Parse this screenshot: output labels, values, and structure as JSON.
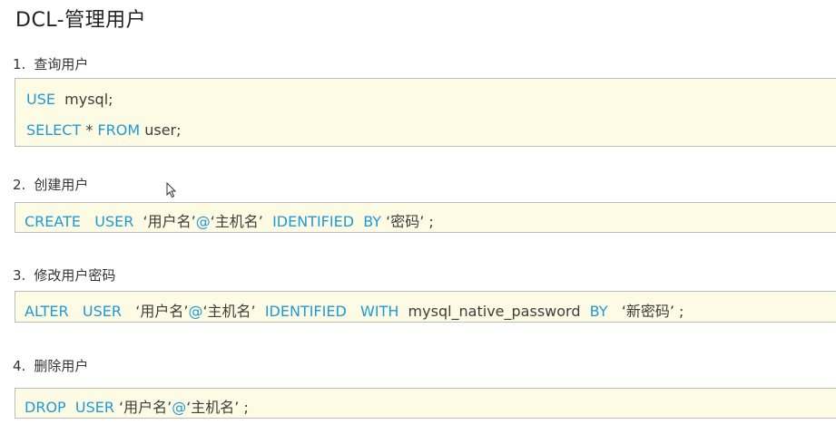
{
  "page": {
    "title": "DCL-管理用户"
  },
  "sections": [
    {
      "number": "1.",
      "heading": "查询用户",
      "code_lines": [
        [
          {
            "text": "USE",
            "kw": true
          },
          {
            "text": "  mysql;",
            "kw": false
          }
        ],
        [
          {
            "text": "SELECT",
            "kw": true
          },
          {
            "text": " * ",
            "kw": false
          },
          {
            "text": "FROM",
            "kw": true
          },
          {
            "text": " user;",
            "kw": false
          }
        ]
      ]
    },
    {
      "number": "2.",
      "heading": "创建用户",
      "code_lines": [
        [
          {
            "text": "CREATE   USER",
            "kw": true
          },
          {
            "text": "  ‘用户名’",
            "kw": false
          },
          {
            "text": "@",
            "kw": true
          },
          {
            "text": "‘主机名’  ",
            "kw": false
          },
          {
            "text": "IDENTIFIED  BY",
            "kw": true
          },
          {
            "text": " ‘密码’ ;",
            "kw": false
          }
        ]
      ]
    },
    {
      "number": "3.",
      "heading": "修改用户密码",
      "code_lines": [
        [
          {
            "text": "ALTER   USER",
            "kw": true
          },
          {
            "text": "   ‘用户名’",
            "kw": false
          },
          {
            "text": "@",
            "kw": true
          },
          {
            "text": "‘主机名’  ",
            "kw": false
          },
          {
            "text": "IDENTIFIED   WITH",
            "kw": true
          },
          {
            "text": "  mysql_native_password  ",
            "kw": false
          },
          {
            "text": "BY",
            "kw": true
          },
          {
            "text": "   ‘新密码’ ;",
            "kw": false
          }
        ]
      ]
    },
    {
      "number": "4.",
      "heading": "删除用户",
      "code_lines": [
        [
          {
            "text": "DROP  USER",
            "kw": true
          },
          {
            "text": " ‘用户名’",
            "kw": false
          },
          {
            "text": "@",
            "kw": true
          },
          {
            "text": "‘主机名’ ;",
            "kw": false
          }
        ]
      ]
    }
  ],
  "colors": {
    "keyword": "#1e9bd7",
    "code_background": "#fdfbe3",
    "code_border": "#bdbdbd",
    "text": "#333333"
  }
}
